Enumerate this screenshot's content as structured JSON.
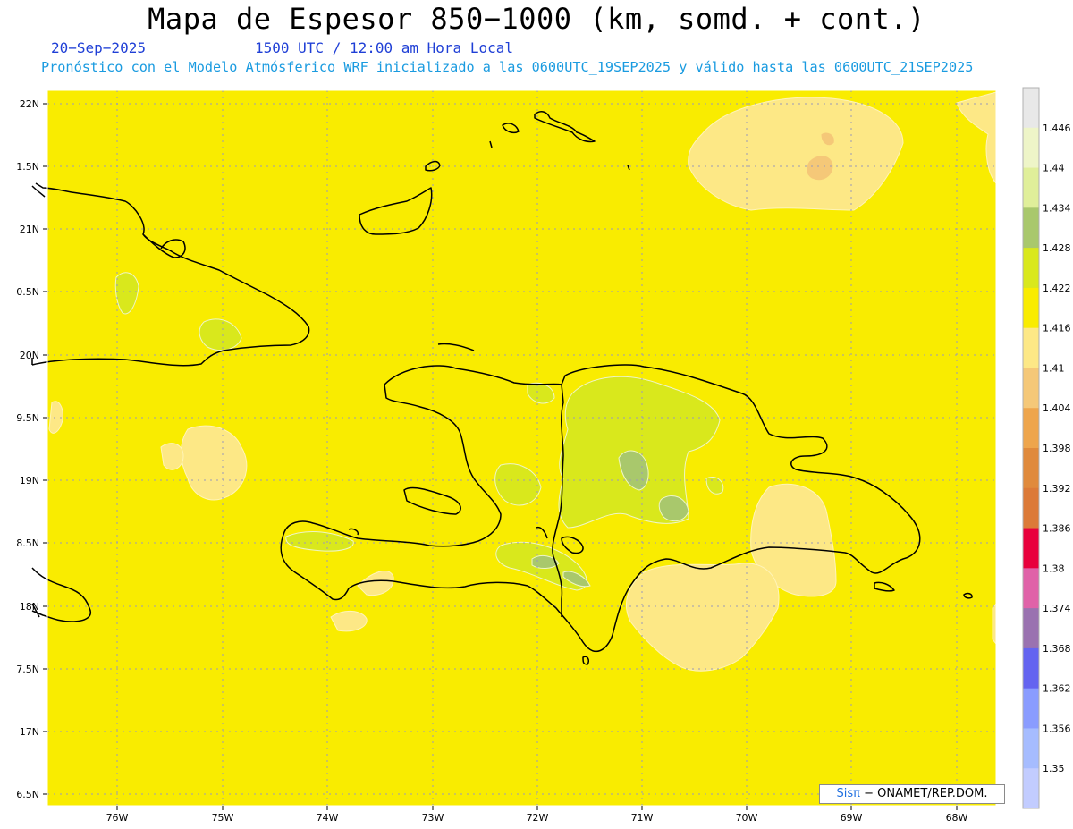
{
  "title": "Mapa de Espesor 850−1000 (km, somd. + cont.)",
  "date": "20−Sep−2025",
  "time_label": "1500 UTC / 12:00 am Hora Local",
  "model_line": "Pronóstico con el Modelo Atmósferico WRF inicializado a las 0600UTC_19SEP2025 y válido hasta las  0600UTC_21SEP2025",
  "axes": {
    "lat_labels": [
      "22N",
      "1.5N",
      "21N",
      "0.5N",
      "20N",
      "9.5N",
      "19N",
      "8.5N",
      "18N",
      "7.5N",
      "17N",
      "6.5N"
    ],
    "lon_labels": [
      "76W",
      "75W",
      "74W",
      "73W",
      "72W",
      "71W",
      "70W",
      "69W",
      "68W"
    ]
  },
  "colorbar": {
    "levels": [
      "1.446",
      "1.44",
      "1.434",
      "1.428",
      "1.422",
      "1.416",
      "1.41",
      "1.404",
      "1.398",
      "1.392",
      "1.386",
      "1.38",
      "1.374",
      "1.368",
      "1.362",
      "1.356",
      "1.35"
    ],
    "colors": [
      "#e8e8e8",
      "#eef5c8",
      "#e0ef9a",
      "#a9c86c",
      "#d9e81c",
      "#f9ec00",
      "#fde886",
      "#f5c878",
      "#eea54c",
      "#e08a3c",
      "#dc7a38",
      "#e8003c",
      "#e062a8",
      "#9a72b0",
      "#6464f0",
      "#8a9cff",
      "#a6bcff",
      "#c2ccff"
    ]
  },
  "map_colors": {
    "background": "#f9ec00",
    "band_1410": "#fde886",
    "band_1404": "#f5c878",
    "band_1422": "#d9e81c",
    "band_1428": "#a9c86c",
    "coast": "#000000",
    "grid": "#9a9ab8"
  },
  "footer": {
    "logo_prefix": "Sis",
    "logo_pi": "π",
    "logo_suffix": "− ONAMET/REP.DOM."
  }
}
